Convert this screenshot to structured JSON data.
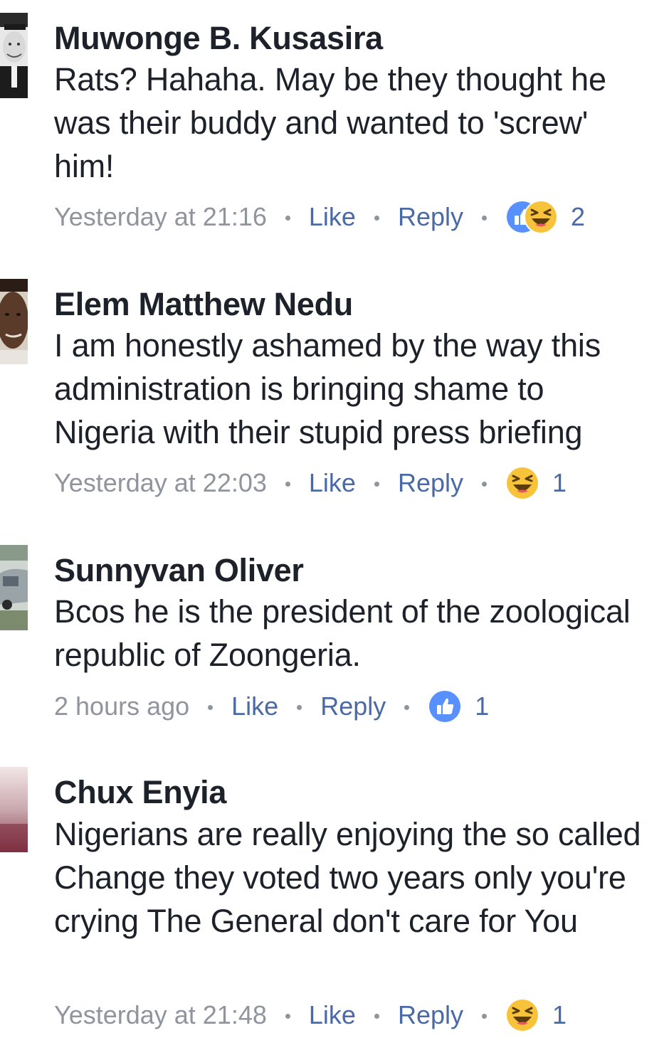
{
  "comments": [
    {
      "author": "Muwonge B. Kusasira",
      "text": "Rats? Hahaha. May be they thought he was their buddy and wanted to 'screw' him!",
      "time": "Yesterday at 21:16",
      "like_label": "Like",
      "reply_label": "Reply",
      "reactions": [
        "like-icon",
        "haha-icon"
      ],
      "reaction_count": "2"
    },
    {
      "author": "Elem Matthew Nedu",
      "text": "I am honestly ashamed by the way this administration is bringing shame to Nigeria with their stupid press briefing",
      "time": "Yesterday at 22:03",
      "like_label": "Like",
      "reply_label": "Reply",
      "reactions": [
        "haha-icon"
      ],
      "reaction_count": "1"
    },
    {
      "author": "Sunnyvan Oliver",
      "text": "Bcos he is the president of the zoological republic of Zoongeria.",
      "time": "2 hours ago",
      "like_label": "Like",
      "reply_label": "Reply",
      "reactions": [
        "like-icon"
      ],
      "reaction_count": "1"
    },
    {
      "author": "Chux Enyia",
      "text": "Nigerians are really enjoying the so called Change they voted two years only you're crying The General don't care for You",
      "time": "Yesterday at 21:48",
      "like_label": "Like",
      "reply_label": "Reply",
      "reactions": [
        "haha-icon"
      ],
      "reaction_count": "1"
    }
  ],
  "colors": {
    "text": "#1d2129",
    "meta": "#90949c",
    "link": "#4b6aa5",
    "like_blue": "#5890ff",
    "haha_yellow": "#f7c33b"
  }
}
